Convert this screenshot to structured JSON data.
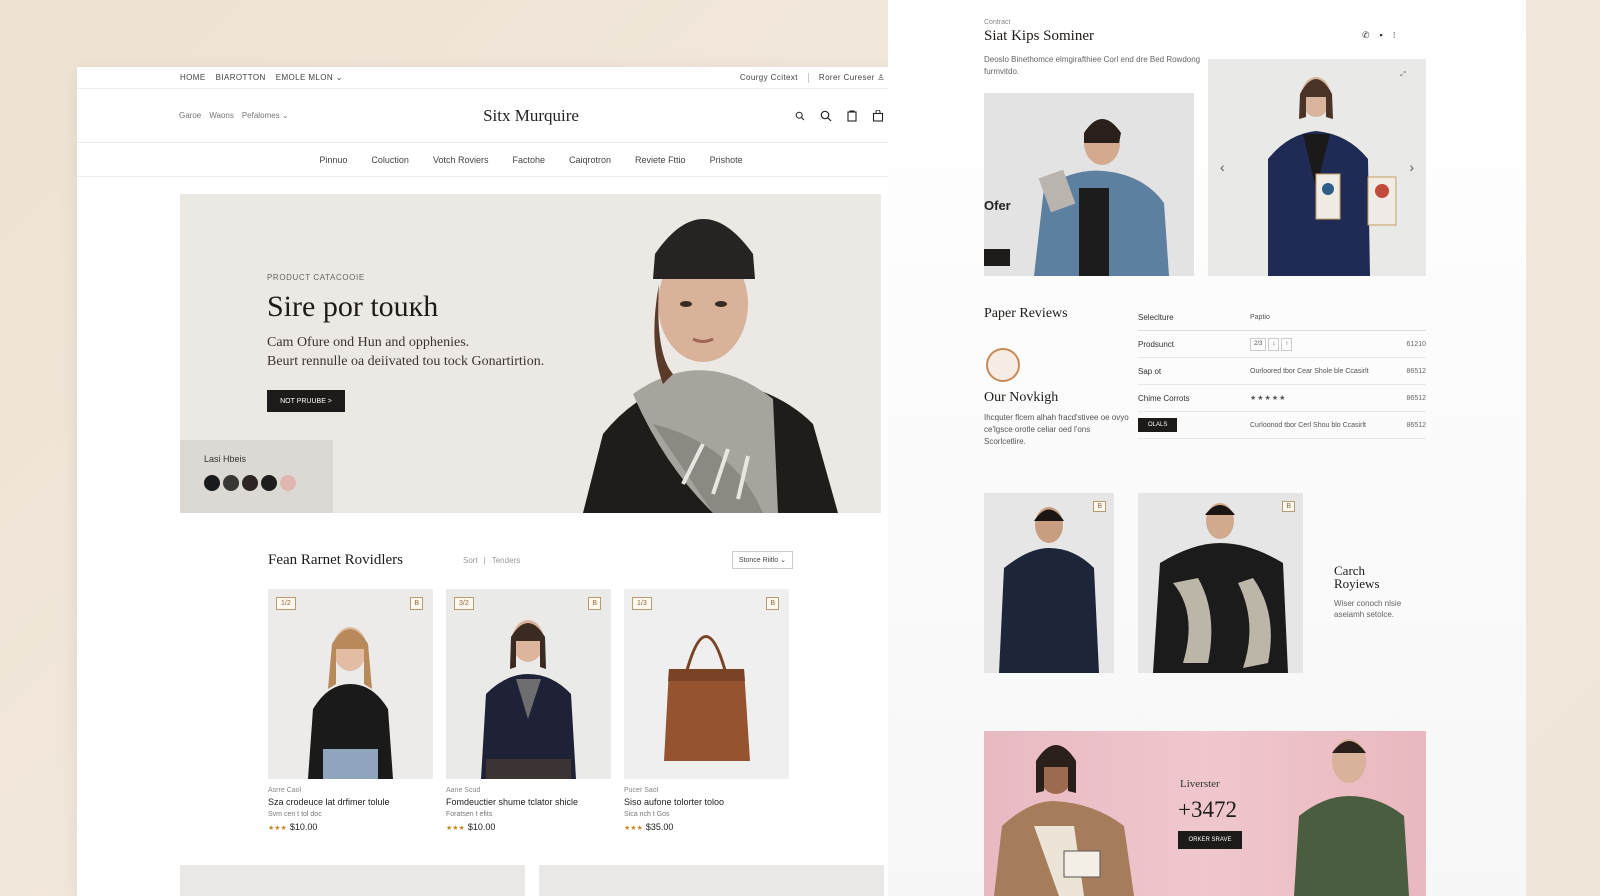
{
  "left": {
    "topbar": {
      "links": [
        "HOME",
        "BIAROTTON",
        "EMOLE MLON"
      ],
      "right_links": [
        "Courgy Ccitext",
        "Rorer Cureser"
      ]
    },
    "header": {
      "left_links": [
        "Garoe",
        "Waons",
        "Pefalomes"
      ],
      "brand": "Sitx Murquire"
    },
    "nav": [
      "Pinnuo",
      "Coluction",
      "Votch Roviers",
      "Factohe",
      "Caiqrotron",
      "Reviete Fttio",
      "Prishote"
    ],
    "hero": {
      "eyebrow": "PRODUCT CATACOOIE",
      "title": "Sire por touкh",
      "line1": "Cam Ofure ond Hun and opphenies.",
      "line2": "Beurt rennulle oa deiivated tou tock Gonartirtion.",
      "cta": "NOT PRUUBE >",
      "swatch_label": "Lasi Hbeis",
      "swatches": [
        "#1a1a1a",
        "#3a3634",
        "#2c2523",
        "#1f1d1b",
        "#e0b6b0"
      ]
    },
    "featured": {
      "title": "Fean Rarnet Rovidlers",
      "filters": [
        "Sort",
        "|",
        "Tenders"
      ],
      "sort_label": "Stonce Riitlo"
    },
    "products": [
      {
        "badge_l": "1/2",
        "badge_r": "B",
        "brand": "Asrre Caol",
        "name": "Sza crodeuce lat drfimer tolule",
        "meta": "Svm cen t tol doc",
        "stars": "★★★",
        "price": "$10.00"
      },
      {
        "badge_l": "3/2",
        "badge_r": "B",
        "brand": "Aane Scud",
        "name": "Fomdeuctier shume tclator shicle",
        "meta": "Foratsen t efits",
        "stars": "★★★",
        "price": "$10.00"
      },
      {
        "badge_l": "1/3",
        "badge_r": "B",
        "brand": "Pucer Saol",
        "name": "Siso aufone tolorter toloo",
        "meta": "Sica nch t Gos",
        "stars": "★★★",
        "price": "$35.00"
      }
    ]
  },
  "right": {
    "eyebrow": "Contract",
    "title": "Siat Kips Sominer",
    "subtitle": "Deoslo Binethomce elmgirafthiee Corl end dre Bed Rowdong furmvitdo.",
    "offer": "Ofer",
    "reviews": {
      "title": "Paper Reviews",
      "headers": [
        "Seleclture",
        "Paptio"
      ],
      "rows": [
        {
          "label": "Prodsunct",
          "detail": "",
          "value": "61210"
        },
        {
          "label": "Sap ot",
          "detail": "Ourloored tbor Cear Shole ble Ccasirlt",
          "value": "86512"
        },
        {
          "label": "Chime Corrots",
          "detail": "",
          "value": "86512"
        },
        {
          "label": "",
          "detail": "Curloonod tbor Cerl Shou blo Ccasirlt",
          "value": "86512"
        }
      ],
      "stars": "★★★★★",
      "mini_buttons": [
        "2/3",
        "↕",
        "↑"
      ],
      "row_button": "OLALS"
    },
    "story": {
      "title": "Our Novkigh",
      "text": "Ihcquter flcem alhah fracd'stivee oe ovyo ce'lgsce orotle celiar oed l'ons Scorlcetlire."
    },
    "catch": {
      "title_line1": "Carch",
      "title_line2": "Royiews",
      "sub": "Wiser conoch nlsie aseiamh setolce."
    },
    "banner": {
      "eyebrow": "Liverster",
      "number": "+3472",
      "cta": "ORKER SRAVE"
    },
    "tile_badge": "B",
    "icons": [
      "phone-icon",
      "chat-icon",
      "menu-icon"
    ]
  },
  "colors": {
    "background": "#eee2d3",
    "dark_button": "#1d1b19",
    "accent_gold": "#b79b73",
    "banner_pink": "#efc7cd"
  }
}
